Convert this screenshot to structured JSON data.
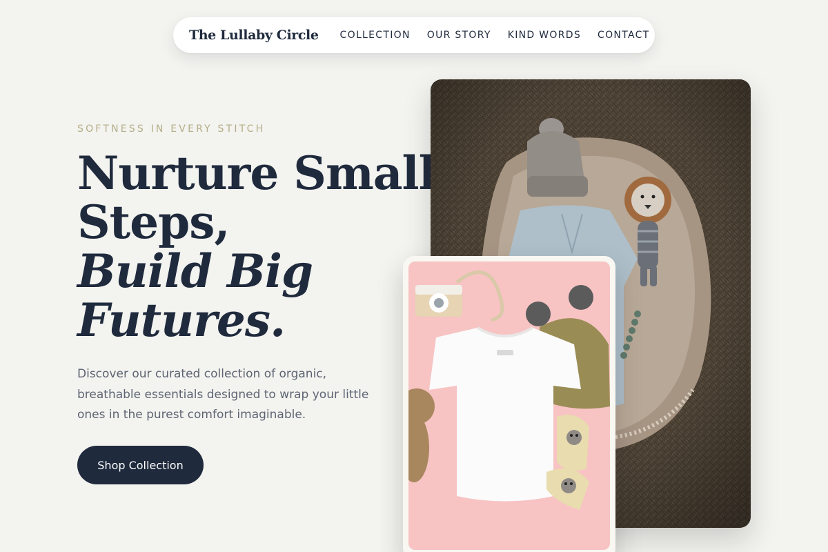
{
  "nav": {
    "brand": "The Lullaby Circle",
    "links": [
      {
        "label": "COLLECTION"
      },
      {
        "label": "OUR STORY"
      },
      {
        "label": "KIND WORDS"
      },
      {
        "label": "CONTACT"
      }
    ]
  },
  "hero": {
    "eyebrow": "SOFTNESS IN EVERY STITCH",
    "headline_line1": "Nurture Small",
    "headline_line2": "Steps,",
    "headline_line3": "Build Big",
    "headline_line4": "Futures.",
    "description": "Discover our curated collection of organic, breathable essentials designed to wrap your little ones in the purest comfort imaginable.",
    "cta_label": "Shop Collection"
  },
  "images": {
    "main_photo": "Baby clothes, knit hat and plush lion arranged on a woven jute rug",
    "card_photo": "White baby t-shirt, knit bear-ear hat, wooden toy camera and socks on pink background"
  },
  "colors": {
    "background": "#f3f3ef",
    "primary": "#1f2a3d",
    "accent": "#b4ad88",
    "muted_text": "#5e6473",
    "card_pink": "#f7c3c3"
  }
}
